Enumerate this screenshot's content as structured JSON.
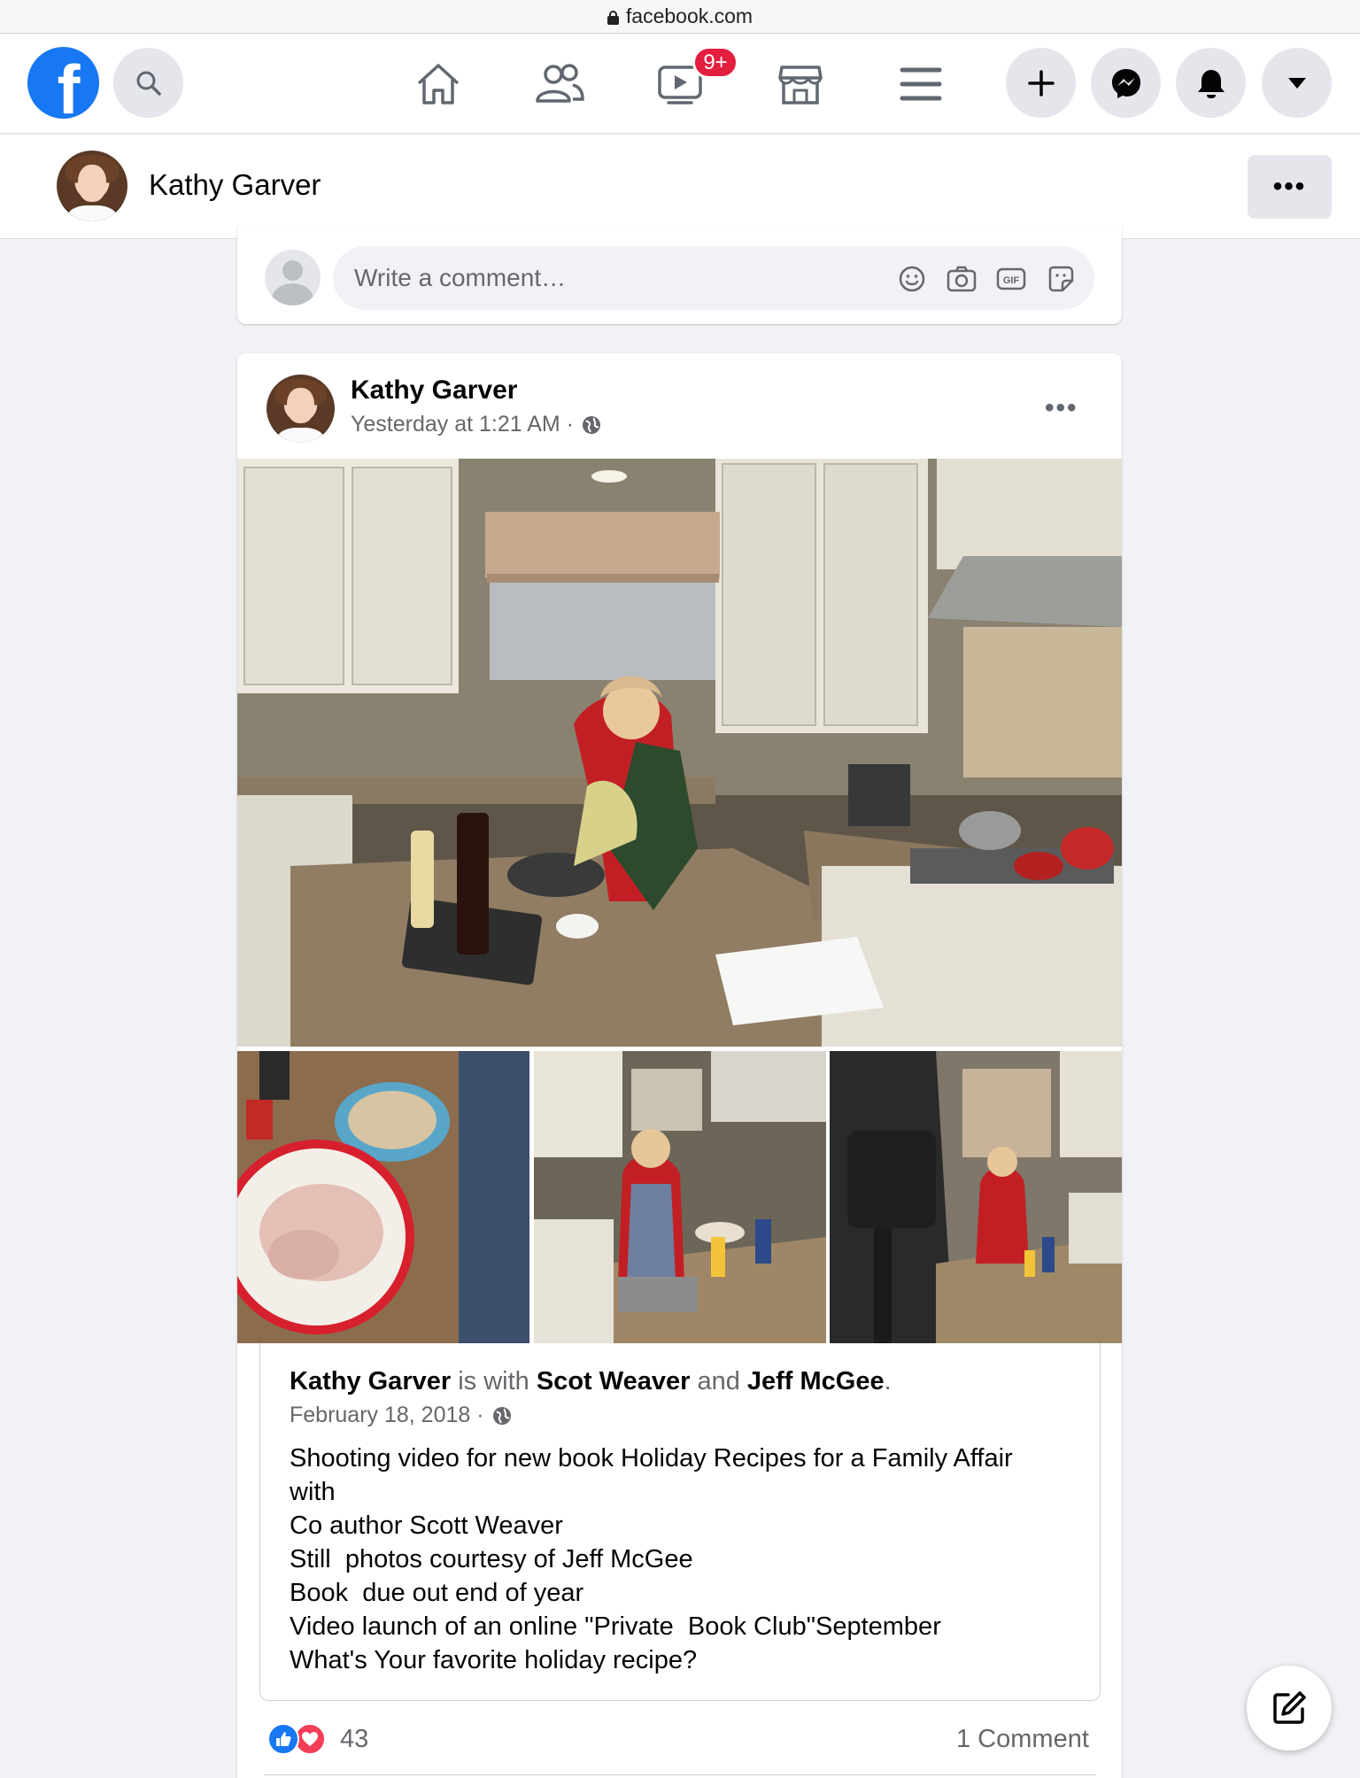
{
  "browser": {
    "url": "facebook.com"
  },
  "topnav": {
    "logo_letter": "f",
    "watch_badge": "9+"
  },
  "profile": {
    "name": "Kathy Garver",
    "more_label": "•••"
  },
  "comment_box": {
    "placeholder": "Write a comment…",
    "icons": [
      "emoji-icon",
      "camera-icon",
      "gif-icon",
      "sticker-icon"
    ],
    "gif_label": "GIF"
  },
  "post": {
    "author": "Kathy Garver",
    "time": "Yesterday at 1:21 AM ·",
    "more_label": "•••",
    "shared": {
      "author": "Kathy Garver",
      "is_with": " is with ",
      "tag1": "Scot Weaver",
      "and": " and ",
      "tag2": "Jeff McGee",
      "period": ".",
      "date": "February 18, 2018 ·",
      "lines": [
        "Shooting video for new book Holiday Recipes for a Family Affair",
        "with",
        "Co author Scott Weaver",
        "Still  photos courtesy of Jeff McGee",
        "Book  due out end of year",
        "Video launch of an online \"Private  Book Club\"September",
        "What's Your favorite holiday recipe?"
      ]
    },
    "reaction_count": "43",
    "comment_count": "1 Comment"
  },
  "colors": {
    "brand": "#1877f2",
    "badge": "#e41e3f",
    "love": "#f33e58",
    "secondary_text": "#65676b"
  }
}
